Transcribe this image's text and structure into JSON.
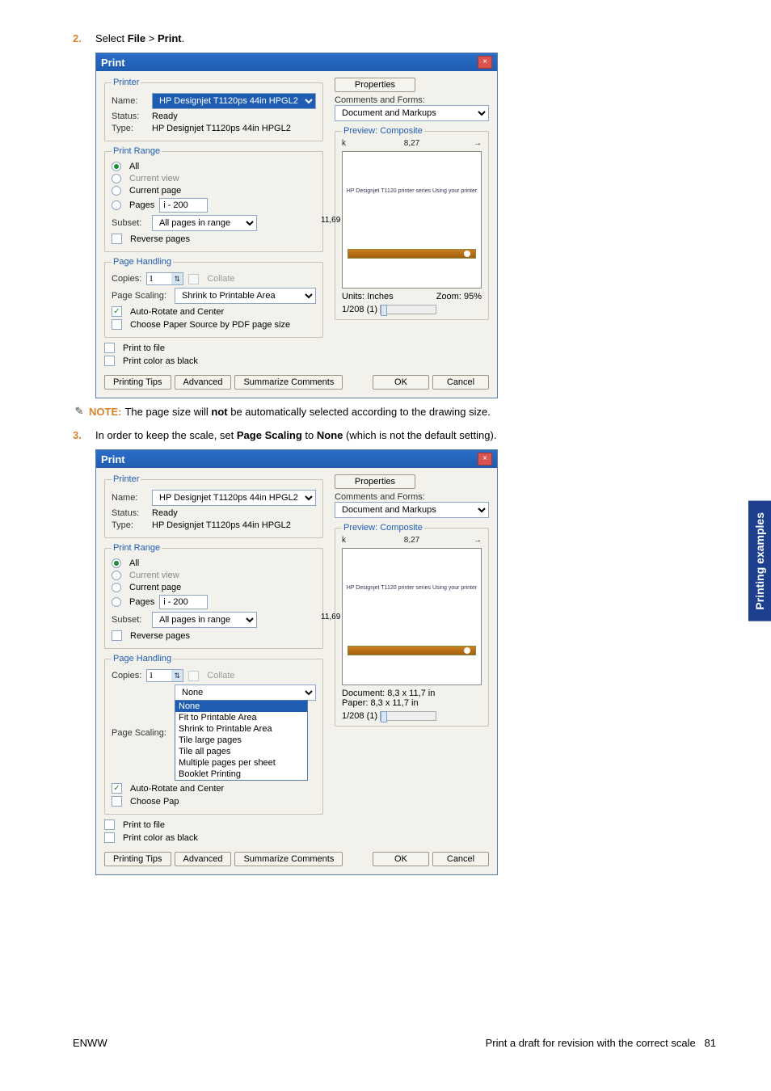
{
  "steps": {
    "s2": {
      "num": "2.",
      "text_pre": "Select ",
      "b1": "File",
      "gt": " > ",
      "b2": "Print",
      "suf": "."
    },
    "s3": {
      "num": "3.",
      "text_pre": "In order to keep the scale, set ",
      "b1": "Page Scaling",
      "mid": " to ",
      "b2": "None",
      "suf": " (which is not the default setting)."
    }
  },
  "note": {
    "label": "NOTE:",
    "text_pre": "The page size will ",
    "b": "not",
    "text_post": " be automatically selected according to the drawing size."
  },
  "dialog_title": "Print",
  "printer": {
    "legend": "Printer",
    "name_lab": "Name:",
    "name_val": "HP Designjet T1120ps 44in HPGL2",
    "status_lab": "Status:",
    "status_val": "Ready",
    "type_lab": "Type:",
    "type_val": "HP Designjet T1120ps 44in HPGL2",
    "props_btn": "Properties",
    "comments_lab": "Comments and Forms:",
    "comments_val": "Document and Markups"
  },
  "range": {
    "legend": "Print Range",
    "all": "All",
    "curview": "Current view",
    "curpage": "Current page",
    "pages_lab": "Pages",
    "pages_val": "i - 200",
    "subset_lab": "Subset:",
    "subset_val": "All pages in range",
    "reverse": "Reverse pages"
  },
  "handling": {
    "legend": "Page Handling",
    "copies_lab": "Copies:",
    "copies_val": "1",
    "collate": "Collate",
    "scaling_lab": "Page Scaling:",
    "scaling_val": "Shrink to Printable Area",
    "autorotate": "Auto-Rotate and Center",
    "choose_src": "Choose Paper Source by PDF page size"
  },
  "handling2": {
    "scaling_val": "None",
    "options": [
      "None",
      "Fit to Printable Area",
      "Shrink to Printable Area",
      "Tile large pages",
      "Tile all pages",
      "Multiple pages per sheet",
      "Booklet Printing"
    ],
    "choose_pap": "Choose Pap"
  },
  "misc": {
    "print_to_file": "Print to file",
    "print_black": "Print color as black"
  },
  "preview": {
    "legend": "Preview: Composite",
    "w": "8,27",
    "h": "11,69",
    "label": "HP Designjet T1120 printer series\nUsing your printer",
    "units_lab": "Units:",
    "units_val": "Inches",
    "zoom_lab": "Zoom:",
    "zoom_val": "95%",
    "doc": "Document: 8,3 x 11,7 in",
    "paper": "Paper: 8,3 x 11,7 in",
    "nav": "1/208 (1)"
  },
  "buttons": {
    "tips": "Printing Tips",
    "adv": "Advanced",
    "sum": "Summarize Comments",
    "ok": "OK",
    "cancel": "Cancel"
  },
  "side_tab": "Printing examples",
  "footer": {
    "left": "ENWW",
    "right_text": "Print a draft for revision with the correct scale",
    "right_num": "81"
  }
}
